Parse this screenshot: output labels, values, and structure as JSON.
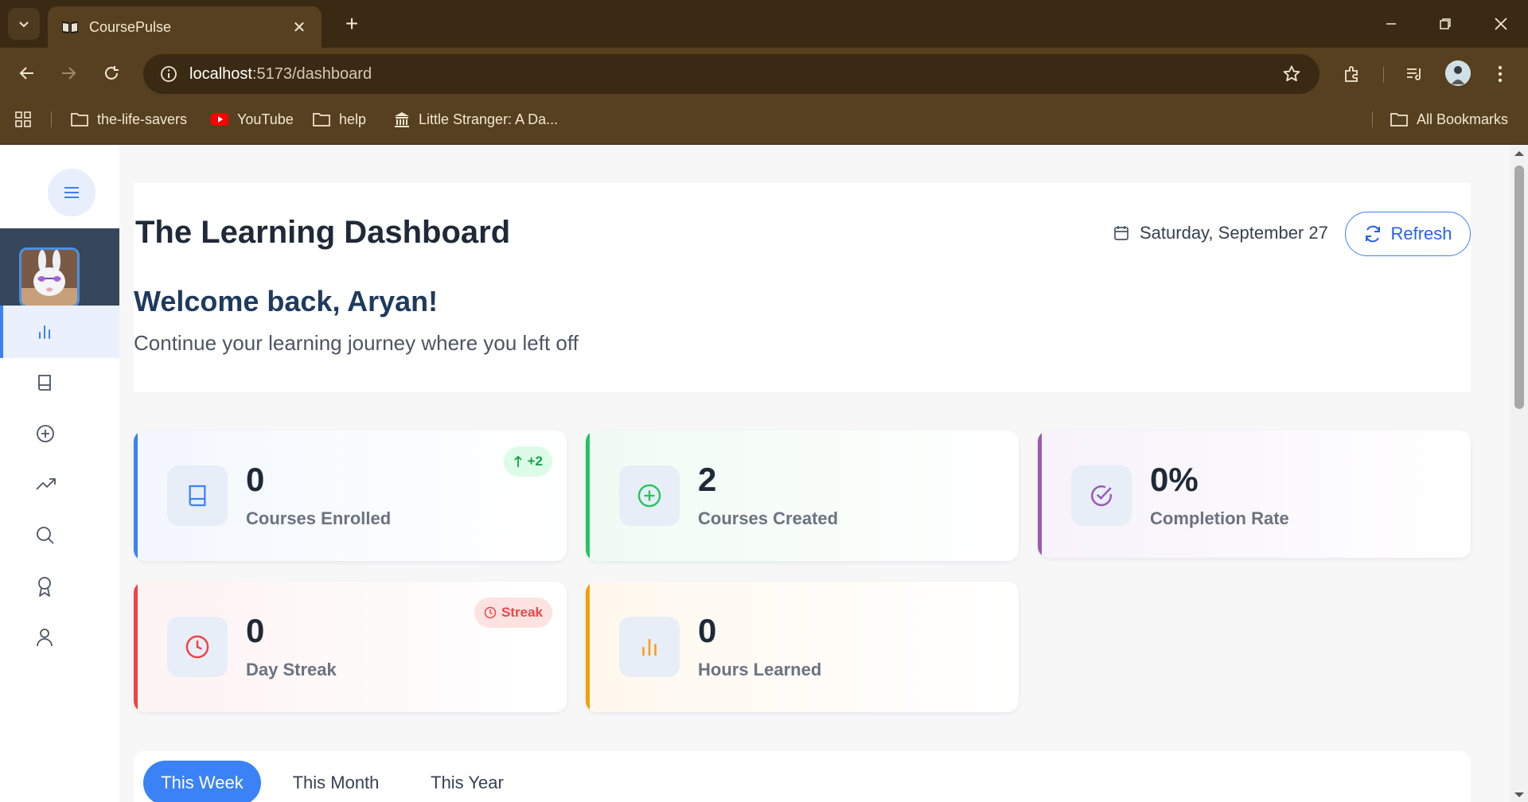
{
  "browser": {
    "tab_title": "CoursePulse",
    "url_host": "localhost",
    "url_path": ":5173/dashboard",
    "bookmarks": [
      {
        "label": "the-life-savers",
        "icon": "folder-icon"
      },
      {
        "label": "YouTube",
        "icon": "youtube-icon"
      },
      {
        "label": "help",
        "icon": "folder-icon"
      },
      {
        "label": "Little Stranger: A Da...",
        "icon": "museum-icon"
      }
    ],
    "all_bookmarks": "All Bookmarks"
  },
  "sidebar": {
    "items": [
      {
        "name": "dashboard",
        "icon": "bar-chart-icon",
        "active": true
      },
      {
        "name": "courses",
        "icon": "book-icon",
        "active": false
      },
      {
        "name": "create-course",
        "icon": "plus-circle-icon",
        "active": false
      },
      {
        "name": "progress",
        "icon": "trending-up-icon",
        "active": false
      },
      {
        "name": "search",
        "icon": "search-icon",
        "active": false
      },
      {
        "name": "achievements",
        "icon": "award-icon",
        "active": false
      },
      {
        "name": "profile",
        "icon": "user-icon",
        "active": false
      }
    ]
  },
  "header": {
    "title": "The Learning Dashboard",
    "date": "Saturday, September 27",
    "refresh_label": "Refresh",
    "welcome": "Welcome back, Aryan!",
    "subtitle": "Continue your learning journey where you left off"
  },
  "stats": [
    {
      "value": "0",
      "label": "Courses Enrolled",
      "badge": "+2",
      "accent": "#3b82f6",
      "icon": "book-icon"
    },
    {
      "value": "2",
      "label": "Courses Created",
      "accent": "#22c55e",
      "icon": "plus-circle-icon"
    },
    {
      "value": "0%",
      "label": "Completion Rate",
      "accent": "#9b59b6",
      "icon": "check-circle-icon"
    },
    {
      "value": "0",
      "label": "Day Streak",
      "badge": "Streak",
      "accent": "#ef4444",
      "icon": "clock-icon"
    },
    {
      "value": "0",
      "label": "Hours Learned",
      "accent": "#f59e0b",
      "icon": "bar-chart-icon"
    }
  ],
  "period_tabs": [
    {
      "label": "This Week",
      "active": true
    },
    {
      "label": "This Month",
      "active": false
    },
    {
      "label": "This Year",
      "active": false
    }
  ],
  "colors": {
    "chrome": "#56401f",
    "chrome_dark": "#3a2a13",
    "primary": "#3b82f6",
    "sidebar_band": "#36475c"
  }
}
